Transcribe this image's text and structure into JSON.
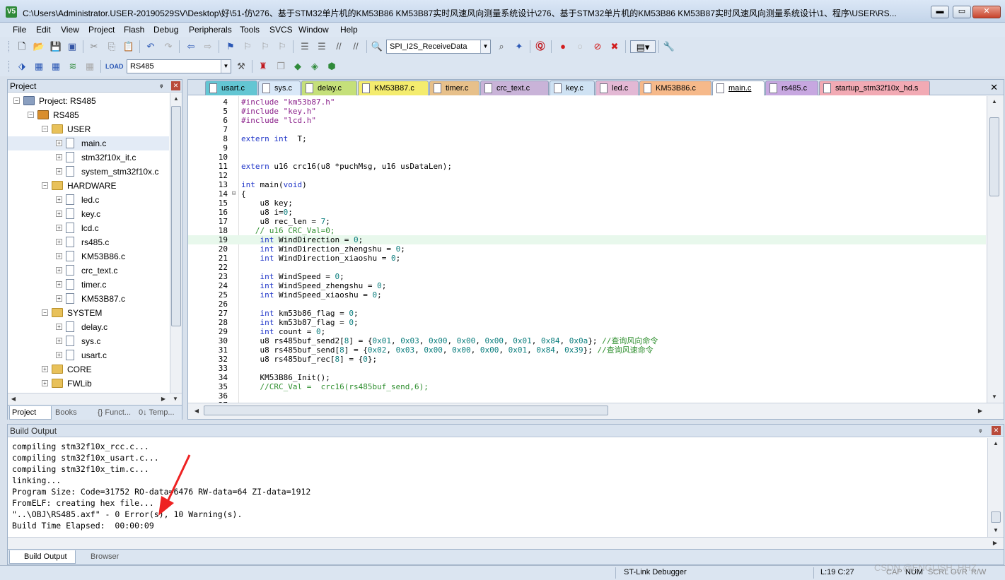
{
  "window": {
    "title": "C:\\Users\\Administrator.USER-20190529SV\\Desktop\\好\\51-仿\\276、基于STM32单片机的KM53B86 KM53B87实时风速风向测量系统设计\\276、基于STM32单片机的KM53B86 KM53B87实时风速风向测量系统设计\\1、程序\\USER\\RS...",
    "app_icon": "V5",
    "minimize": "▬",
    "maximize": "▭",
    "close": "✕"
  },
  "menu": [
    "File",
    "Edit",
    "View",
    "Project",
    "Flash",
    "Debug",
    "Peripherals",
    "Tools",
    "SVCS",
    "Window",
    "Help"
  ],
  "toolbar": {
    "function_combo": "SPI_I2S_ReceiveData",
    "target_combo": "RS485"
  },
  "project_panel": {
    "title": "Project",
    "pin": "ᵠ",
    "close": "✕",
    "tree": [
      {
        "label": "Project: RS485",
        "level": 0,
        "kind": "project",
        "expanded": true
      },
      {
        "label": "RS485",
        "level": 1,
        "kind": "target",
        "expanded": true
      },
      {
        "label": "USER",
        "level": 2,
        "kind": "folder",
        "expanded": true
      },
      {
        "label": "main.c",
        "level": 3,
        "kind": "file",
        "selected": true
      },
      {
        "label": "stm32f10x_it.c",
        "level": 3,
        "kind": "file"
      },
      {
        "label": "system_stm32f10x.c",
        "level": 3,
        "kind": "file"
      },
      {
        "label": "HARDWARE",
        "level": 2,
        "kind": "folder",
        "expanded": true
      },
      {
        "label": "led.c",
        "level": 3,
        "kind": "file"
      },
      {
        "label": "key.c",
        "level": 3,
        "kind": "file"
      },
      {
        "label": "lcd.c",
        "level": 3,
        "kind": "file"
      },
      {
        "label": "rs485.c",
        "level": 3,
        "kind": "file"
      },
      {
        "label": "KM53B86.c",
        "level": 3,
        "kind": "file"
      },
      {
        "label": "crc_text.c",
        "level": 3,
        "kind": "file"
      },
      {
        "label": "timer.c",
        "level": 3,
        "kind": "file"
      },
      {
        "label": "KM53B87.c",
        "level": 3,
        "kind": "file"
      },
      {
        "label": "SYSTEM",
        "level": 2,
        "kind": "folder",
        "expanded": true
      },
      {
        "label": "delay.c",
        "level": 3,
        "kind": "file"
      },
      {
        "label": "sys.c",
        "level": 3,
        "kind": "file"
      },
      {
        "label": "usart.c",
        "level": 3,
        "kind": "file"
      },
      {
        "label": "CORE",
        "level": 2,
        "kind": "folder",
        "expanded": false
      },
      {
        "label": "FWLib",
        "level": 2,
        "kind": "folder",
        "expanded": false
      }
    ],
    "tabs": [
      "Project",
      "Books",
      "{} Funct...",
      "0↓ Temp..."
    ]
  },
  "editor": {
    "tabs": [
      {
        "label": "usart.c",
        "color": "#63c6d3"
      },
      {
        "label": "sys.c",
        "color": "#d9e8f8"
      },
      {
        "label": "delay.c",
        "color": "#c5e07a"
      },
      {
        "label": "KM53B87.c",
        "color": "#f4ec6e"
      },
      {
        "label": "timer.c",
        "color": "#e7c08a"
      },
      {
        "label": "crc_text.c",
        "color": "#c9b3d8"
      },
      {
        "label": "key.c",
        "color": "#cfe2f3"
      },
      {
        "label": "led.c",
        "color": "#e3b8d4"
      },
      {
        "label": "KM53B86.c",
        "color": "#f6b98a"
      },
      {
        "label": "main.c",
        "color": "#ffffff",
        "active": true
      },
      {
        "label": "rs485.c",
        "color": "#c7a7e0"
      },
      {
        "label": "startup_stm32f10x_hd.s",
        "color": "#f2aab4"
      }
    ],
    "close_all": "✕",
    "lines": [
      {
        "n": "4",
        "html": "<span class='pp'>#include \"km53b87.h\"</span>"
      },
      {
        "n": "5",
        "html": "<span class='pp'>#include \"key.h\"</span>"
      },
      {
        "n": "6",
        "html": "<span class='pp'>#include \"lcd.h\"</span>"
      },
      {
        "n": "7",
        "html": ""
      },
      {
        "n": "8",
        "html": "<span class='kw'>extern int</span>  T;"
      },
      {
        "n": "9",
        "html": ""
      },
      {
        "n": "10",
        "html": ""
      },
      {
        "n": "11",
        "html": "<span class='kw'>extern</span> u16 crc16(u8 *puchMsg, u16 usDataLen);"
      },
      {
        "n": "12",
        "html": ""
      },
      {
        "n": "13",
        "html": "<span class='kw'>int</span> main(<span class='kw'>void</span>)"
      },
      {
        "n": "14",
        "html": "{",
        "fold": "⊟"
      },
      {
        "n": "15",
        "html": "    u8 key;"
      },
      {
        "n": "16",
        "html": "    u8 i=<span class='num'>0</span>;"
      },
      {
        "n": "17",
        "html": "    u8 rec_len = <span class='num'>7</span>;"
      },
      {
        "n": "18",
        "html": "   <span class='cm'>// u16 CRC_Val=0;</span>"
      },
      {
        "n": "19",
        "html": "    <span class='kw'>int</span> WindDirection = <span class='num'>0</span>;",
        "hl": true
      },
      {
        "n": "20",
        "html": "    <span class='kw'>int</span> WindDirection_zhengshu = <span class='num'>0</span>;"
      },
      {
        "n": "21",
        "html": "    <span class='kw'>int</span> WindDirection_xiaoshu = <span class='num'>0</span>;"
      },
      {
        "n": "22",
        "html": ""
      },
      {
        "n": "23",
        "html": "    <span class='kw'>int</span> WindSpeed = <span class='num'>0</span>;"
      },
      {
        "n": "24",
        "html": "    <span class='kw'>int</span> WindSpeed_zhengshu = <span class='num'>0</span>;"
      },
      {
        "n": "25",
        "html": "    <span class='kw'>int</span> WindSpeed_xiaoshu = <span class='num'>0</span>;"
      },
      {
        "n": "26",
        "html": ""
      },
      {
        "n": "27",
        "html": "    <span class='kw'>int</span> km53b86_flag = <span class='num'>0</span>;"
      },
      {
        "n": "28",
        "html": "    <span class='kw'>int</span> km53b87_flag = <span class='num'>0</span>;"
      },
      {
        "n": "29",
        "html": "    <span class='kw'>int</span> count = <span class='num'>0</span>;"
      },
      {
        "n": "30",
        "html": "    u8 rs485buf_send2[<span class='num'>8</span>] = {<span class='num'>0x01</span>, <span class='num'>0x03</span>, <span class='num'>0x00</span>, <span class='num'>0x00</span>, <span class='num'>0x00</span>, <span class='num'>0x01</span>, <span class='num'>0x84</span>, <span class='num'>0x0a</span>}; <span class='cm'>//查询风向命令</span>"
      },
      {
        "n": "31",
        "html": "    u8 rs485buf_send[<span class='num'>8</span>] = {<span class='num'>0x02</span>, <span class='num'>0x03</span>, <span class='num'>0x00</span>, <span class='num'>0x00</span>, <span class='num'>0x00</span>, <span class='num'>0x01</span>, <span class='num'>0x84</span>, <span class='num'>0x39</span>}; <span class='cm'>//查询风速命令</span>"
      },
      {
        "n": "32",
        "html": "    u8 rs485buf_rec[<span class='num'>8</span>] = {<span class='num'>0</span>};"
      },
      {
        "n": "33",
        "html": ""
      },
      {
        "n": "34",
        "html": "    KM53B86_Init();"
      },
      {
        "n": "35",
        "html": "    <span class='cm'>//CRC_Val =  crc16(rs485buf_send,6);</span>"
      },
      {
        "n": "36",
        "html": ""
      },
      {
        "n": "37",
        "html": ""
      }
    ]
  },
  "build_output": {
    "title": "Build Output",
    "lines": [
      "compiling stm32f10x_rcc.c...",
      "compiling stm32f10x_usart.c...",
      "compiling stm32f10x_tim.c...",
      "linking...",
      "Program Size: Code=31752 RO-data=6476 RW-data=64 ZI-data=1912",
      "FromELF: creating hex file...",
      "\"..\\OBJ\\RS485.axf\" - 0 Error(s), 10 Warning(s).",
      "Build Time Elapsed:  00:00:09"
    ],
    "tabs": [
      "Build Output",
      "Browser"
    ]
  },
  "statusbar": {
    "debugger": "ST-Link Debugger",
    "position": "L:19 C:27",
    "indicators": [
      "CAP",
      "NUM",
      "SCRL",
      "OVR",
      "R/W"
    ]
  },
  "watermark": "CSDN @ENGLISH_HHZ",
  "colors": {
    "highlight_line": "#e8f8ec",
    "keyword": "#1f35c8",
    "comment": "#2f8f2f",
    "preproc": "#8a1f8a",
    "number": "#0a7d7d",
    "annotation_arrow": "#ee2222"
  }
}
